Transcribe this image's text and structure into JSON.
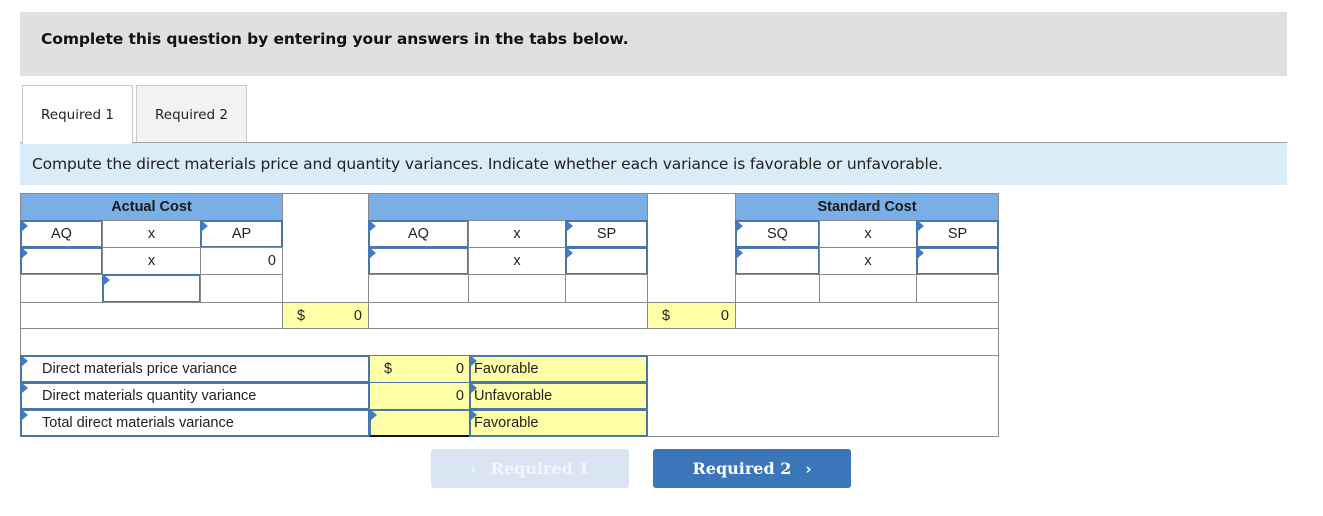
{
  "header": {
    "instruction": "Complete this question by entering your answers in the tabs below."
  },
  "tabs": [
    {
      "label": "Required 1",
      "active": true
    },
    {
      "label": "Required 2",
      "active": false
    }
  ],
  "prompt": "Compute the direct materials price and quantity variances. Indicate whether each variance is favorable or unfavorable.",
  "table": {
    "actual_cost": {
      "title": "Actual Cost",
      "labels": {
        "q": "AQ",
        "op": "x",
        "p": "AP"
      },
      "row2": {
        "q": "",
        "op": "x",
        "p": "0"
      },
      "row3_input": "",
      "total": {
        "currency": "$",
        "value": "0"
      }
    },
    "middle": {
      "title": "",
      "labels": {
        "q": "AQ",
        "op": "x",
        "p": "SP"
      },
      "row2": {
        "q": "",
        "op": "x",
        "p": ""
      },
      "total": {
        "currency": "$",
        "value": "0"
      }
    },
    "standard_cost": {
      "title": "Standard Cost",
      "labels": {
        "q": "SQ",
        "op": "x",
        "p": "SP"
      },
      "row2": {
        "q": "",
        "op": "x",
        "p": ""
      }
    },
    "variances": [
      {
        "label": "Direct materials price variance",
        "currency": "$",
        "amount": "0",
        "type": "Favorable"
      },
      {
        "label": "Direct materials quantity variance",
        "currency": "",
        "amount": "0",
        "type": "Unfavorable"
      },
      {
        "label": "Total direct materials variance",
        "currency": "",
        "amount": "",
        "type": "Favorable"
      }
    ]
  },
  "nav": {
    "prev_label": "Required 1",
    "prev_icon": "‹",
    "next_label": "Required 2",
    "next_icon": "›"
  },
  "colors": {
    "header_bg": "#e0e0e0",
    "prompt_bg": "#dbecf9",
    "table_header": "#7aaee6",
    "answer_yellow": "#ffffa8",
    "input_border": "#4a76a8",
    "next_button": "#3a76b9",
    "prev_button_disabled": "#d9e5f2"
  }
}
